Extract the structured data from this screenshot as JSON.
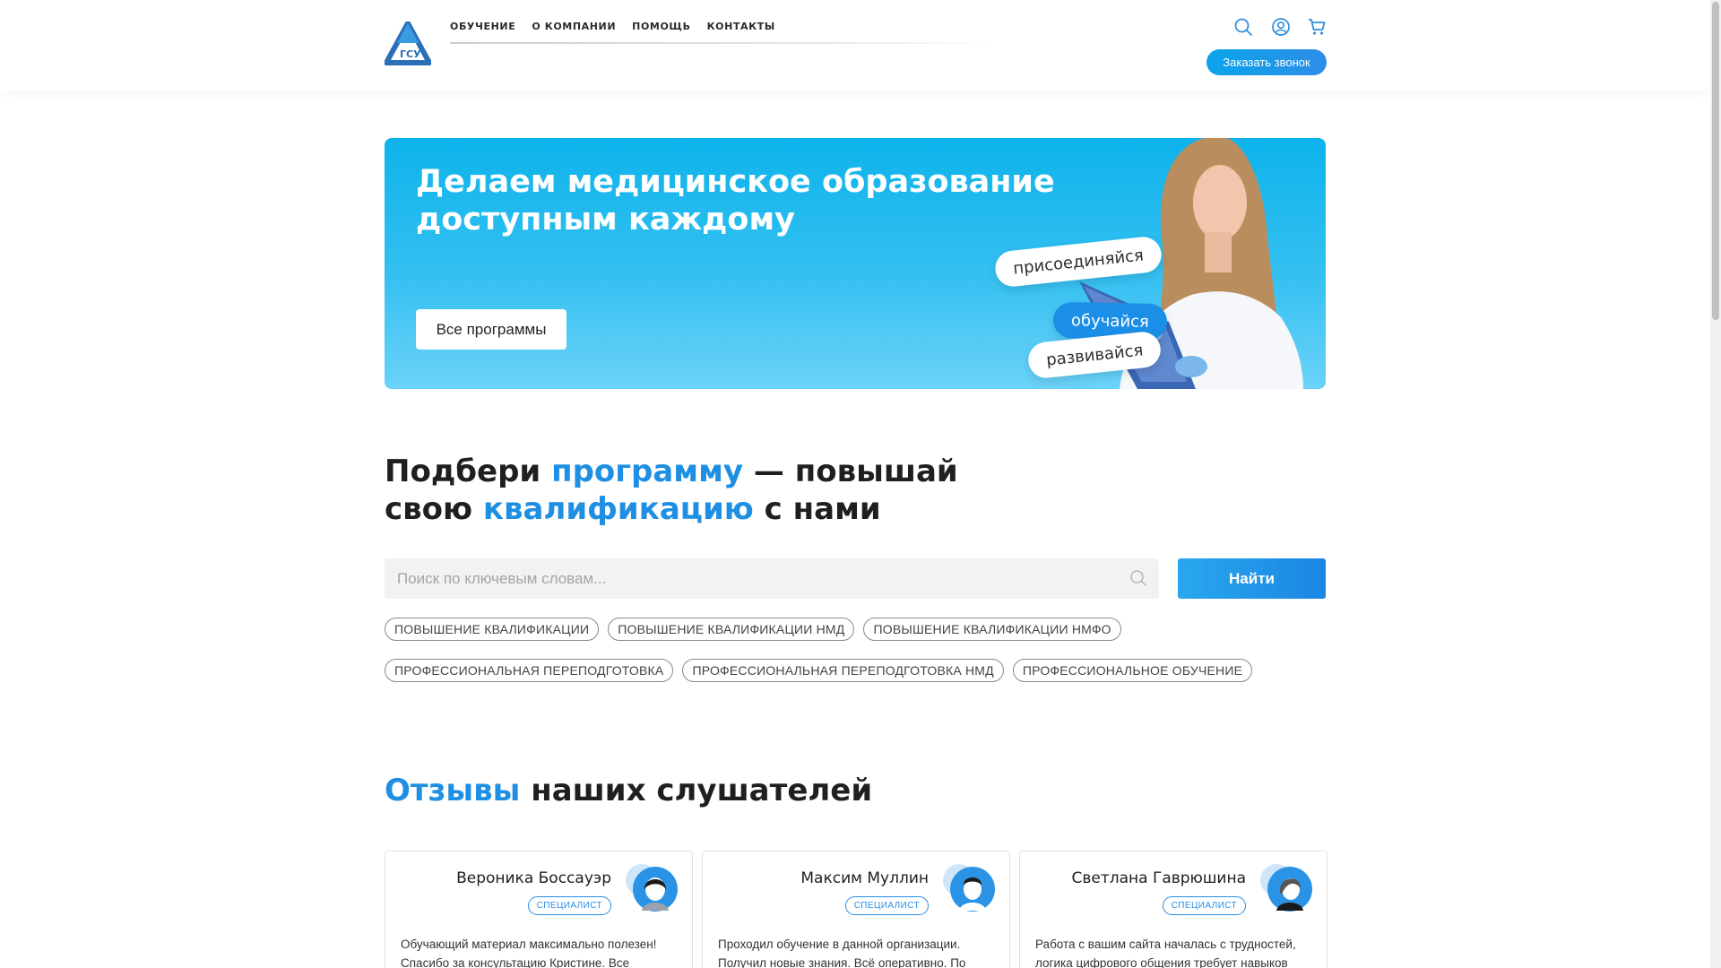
{
  "brand": {
    "logo_text": "ГСУ",
    "accent_color": "#1e8fe3",
    "hero_color": "#1ab6ee"
  },
  "nav": {
    "items": [
      {
        "label": "ОБУЧЕНИЕ"
      },
      {
        "label": "О КОМПАНИИ"
      },
      {
        "label": "ПОМОЩЬ"
      },
      {
        "label": "КОНТАКТЫ"
      }
    ]
  },
  "header": {
    "icons": [
      "search-icon",
      "user-icon",
      "cart-icon"
    ],
    "callback_label": "Заказать звонок"
  },
  "hero": {
    "title": "Делаем медицинское образование доступным каждому",
    "button_label": "Все программы",
    "pills": [
      "присоединяйся",
      "обучайся",
      "развивайся"
    ]
  },
  "programs": {
    "title_part1": "Подбери ",
    "title_accent1": "программу",
    "title_part2": " — повышай",
    "title_part3": "свою ",
    "title_accent2": "квалификацию",
    "title_part4": " с нами",
    "search_placeholder": "Поиск по ключевым словам...",
    "find_label": "Найти",
    "tags": [
      "ПОВЫШЕНИЕ КВАЛИФИКАЦИИ",
      "ПОВЫШЕНИЕ КВАЛИФИКАЦИИ НМД",
      "ПОВЫШЕНИЕ КВАЛИФИКАЦИИ НМФО",
      "ПРОФЕССИОНАЛЬНАЯ ПЕРЕПОДГОТОВКА",
      "ПРОФЕССИОНАЛЬНАЯ ПЕРЕПОДГОТОВКА НМД",
      "ПРОФЕССИОНАЛЬНОЕ ОБУЧЕНИЕ"
    ]
  },
  "reviews": {
    "title_accent": "Отзывы",
    "title_rest": " наших слушателей",
    "items": [
      {
        "name": "Вероника Боссауэр",
        "role": "СПЕЦИАЛИСТ",
        "text": "Обучающий материал максимально полезен! Спасибо за консультацию Кристине. Все"
      },
      {
        "name": "Максим Муллин",
        "role": "СПЕЦИАЛИСТ",
        "text": "Проходил обучение в данной организации. Получил новые знания. Всё оперативно. По"
      },
      {
        "name": "Светлана Гаврюшина",
        "role": "СПЕЦИАЛИСТ",
        "text": "Работа с вашим сайта началась с трудностей, логика цифрового общения требует навыков"
      }
    ]
  }
}
